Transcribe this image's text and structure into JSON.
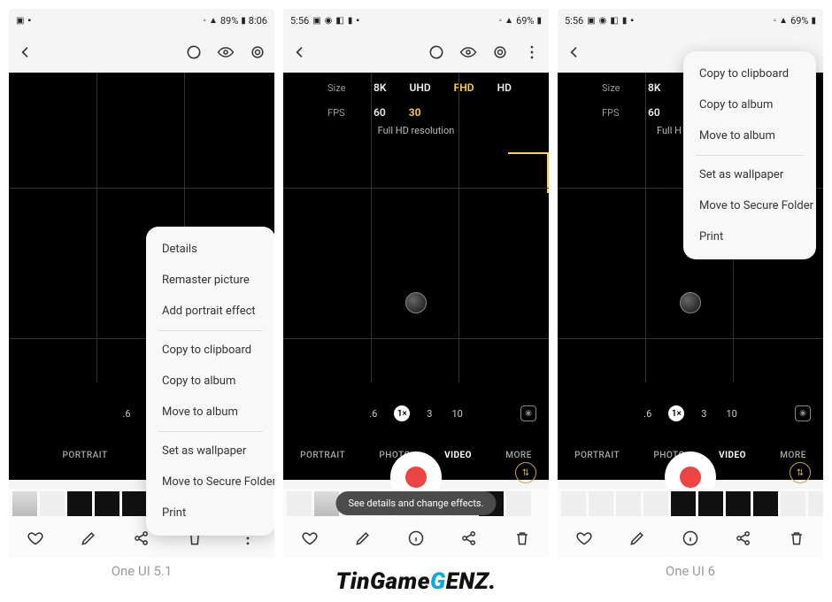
{
  "status": {
    "time": "5:56",
    "battery1": "89%",
    "clock1": "8:06",
    "battery2": "69%"
  },
  "camera": {
    "sizeLabel": "Size",
    "fpsLabel": "FPS",
    "sizes": [
      "8K",
      "UHD",
      "FHD",
      "HD"
    ],
    "fps": [
      "60",
      "30"
    ],
    "resText": "Full HD resolution",
    "zooms": [
      ".6",
      "1×",
      "3",
      "10"
    ],
    "modes": [
      "PORTRAIT",
      "PHOTO",
      "VIDEO",
      "MORE"
    ]
  },
  "menu1": {
    "items1": [
      "Details",
      "Remaster picture",
      "Add portrait effect"
    ],
    "items2": [
      "Copy to clipboard",
      "Copy to album",
      "Move to album"
    ],
    "items3": [
      "Set as wallpaper",
      "Move to Secure Folder",
      "Print"
    ]
  },
  "menu2": {
    "items1": [
      "Copy to clipboard",
      "Copy to album",
      "Move to album"
    ],
    "items2": [
      "Set as wallpaper",
      "Move to Secure Folder",
      "Print"
    ]
  },
  "tooltip": "See details and change effects.",
  "captions": [
    "One UI 5.1",
    "One UI 6"
  ],
  "watermark": {
    "a": "TinGame",
    "b": "G",
    "c": "ENZ."
  }
}
